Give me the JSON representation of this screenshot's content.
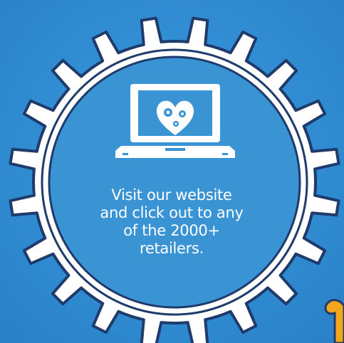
{
  "promo": {
    "lines": [
      "Visit our website",
      "and click out to any",
      "of the 2000+",
      "retailers."
    ]
  },
  "icons": {
    "laptop": "laptop-icon",
    "gears_heart": "gears-heart-icon",
    "puzzle_piece": "puzzle-piece-icon"
  },
  "colors": {
    "background": "#2f8fd6",
    "gear_fill": "#3a94d4",
    "gear_outline": "#ffffff",
    "gear_stroke": "#1f3b6b",
    "puzzle": "#f3a51c",
    "text": "#ffffff"
  }
}
